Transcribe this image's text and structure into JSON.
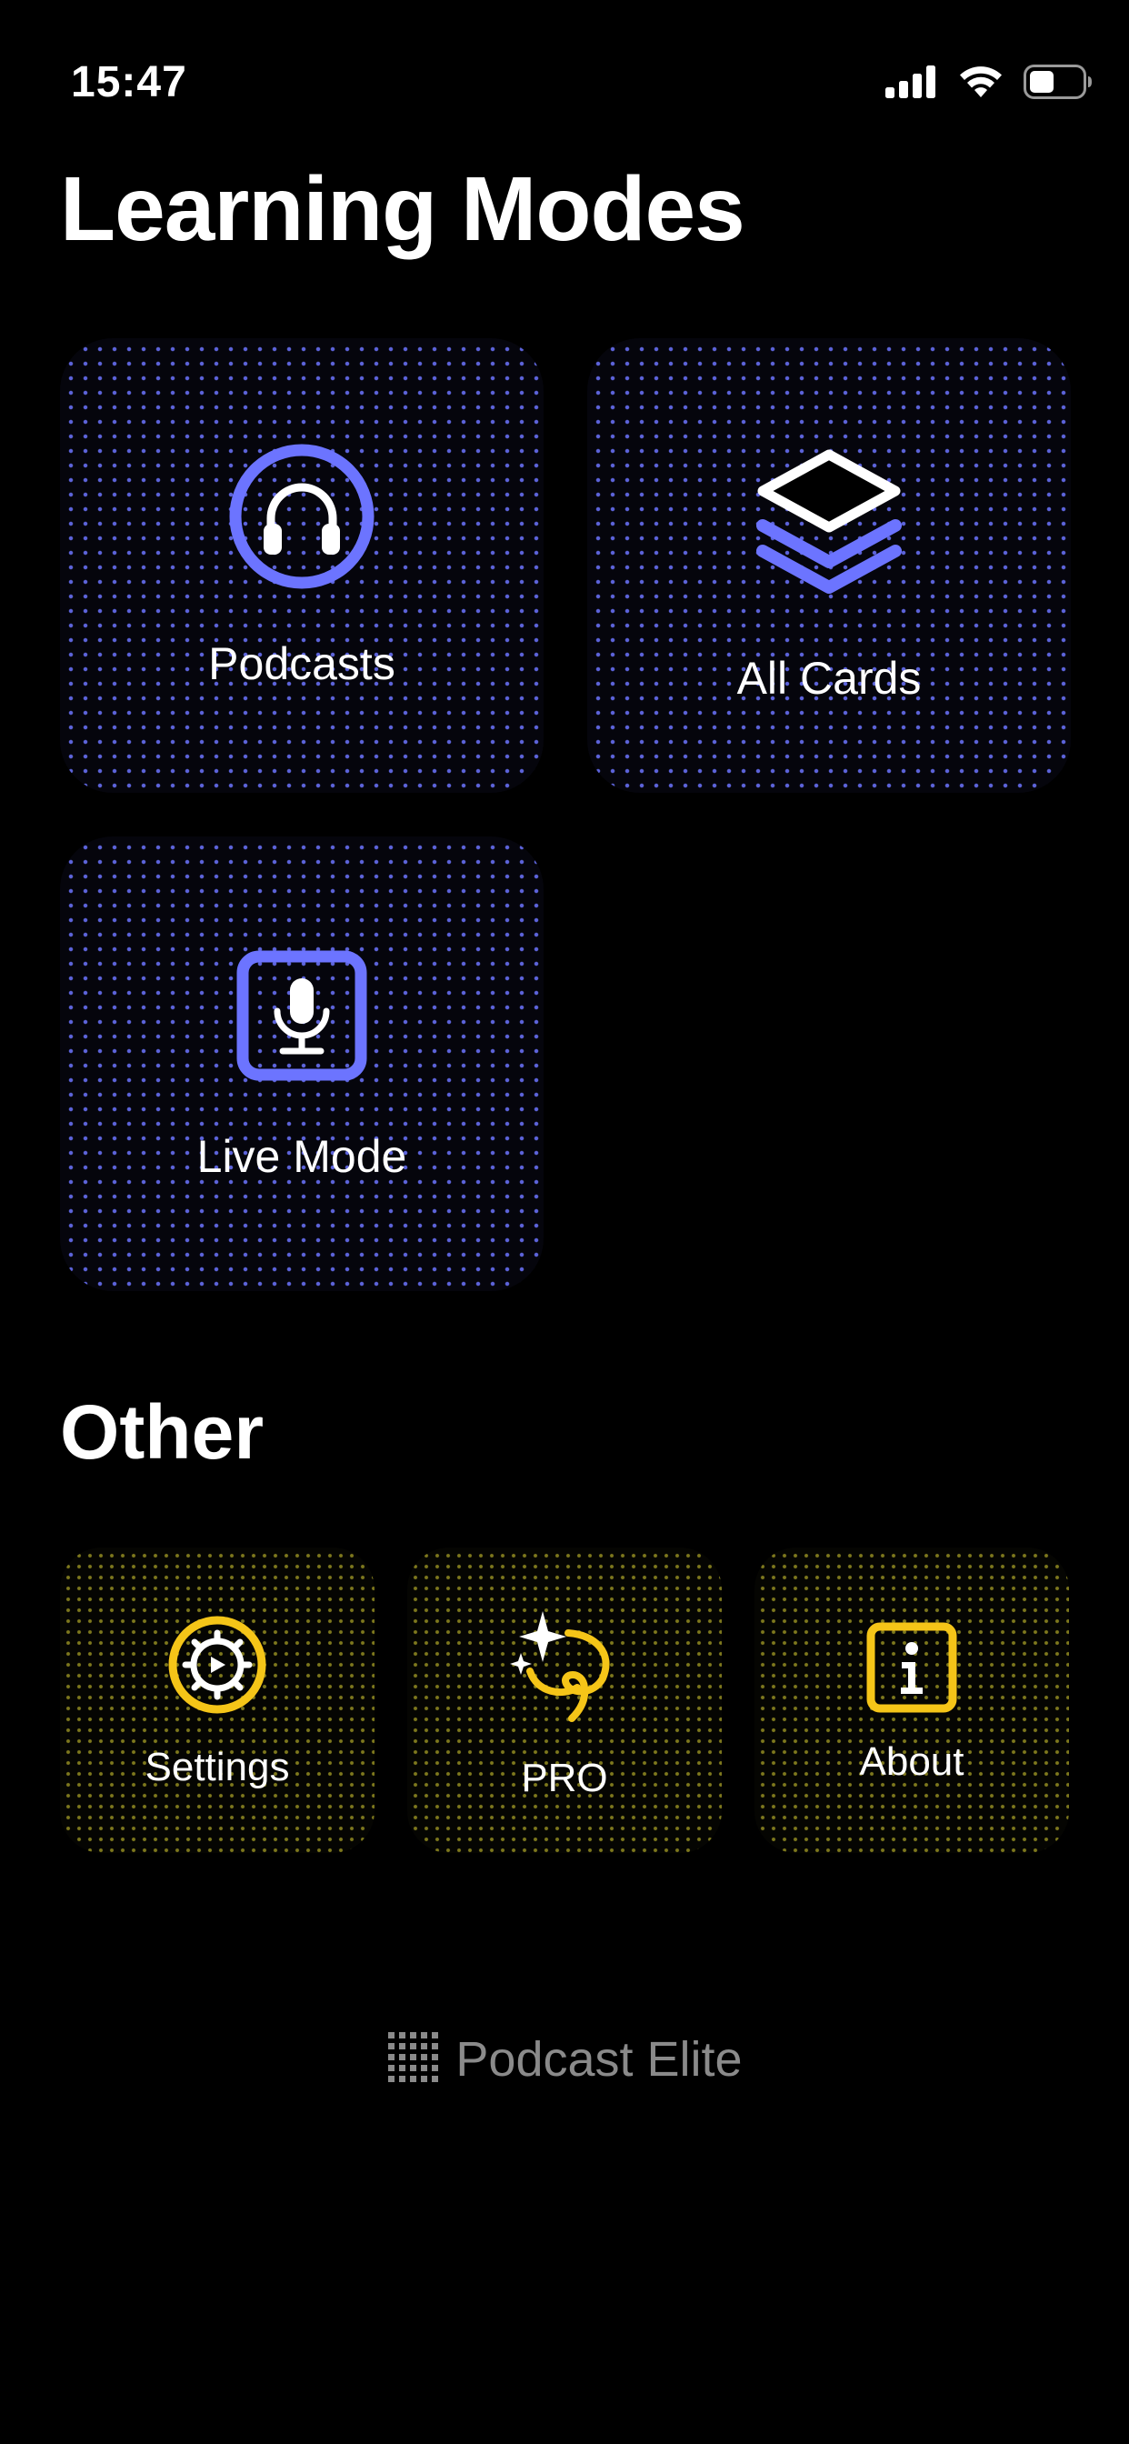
{
  "status_bar": {
    "time": "15:47",
    "icons": [
      "cellular-signal-icon",
      "wifi-icon",
      "battery-icon"
    ]
  },
  "learning_modes": {
    "title": "Learning Modes",
    "cards": [
      {
        "label": "Podcasts",
        "icon": "headphones-icon"
      },
      {
        "label": "All Cards",
        "icon": "stack-layers-icon"
      },
      {
        "label": "Live Mode",
        "icon": "microphone-icon"
      }
    ]
  },
  "other": {
    "title": "Other",
    "cards": [
      {
        "label": "Settings",
        "icon": "gear-icon"
      },
      {
        "label": "PRO",
        "icon": "sparkle-ribbon-icon"
      },
      {
        "label": "About",
        "icon": "info-icon"
      }
    ]
  },
  "footer": {
    "brand": "Podcast Elite",
    "icon": "dot-grid-logo-icon"
  },
  "colors": {
    "background": "#000000",
    "accent_blue": "#6c74ff",
    "accent_yellow": "#f5c518",
    "footer_text": "#8a8a8a"
  }
}
